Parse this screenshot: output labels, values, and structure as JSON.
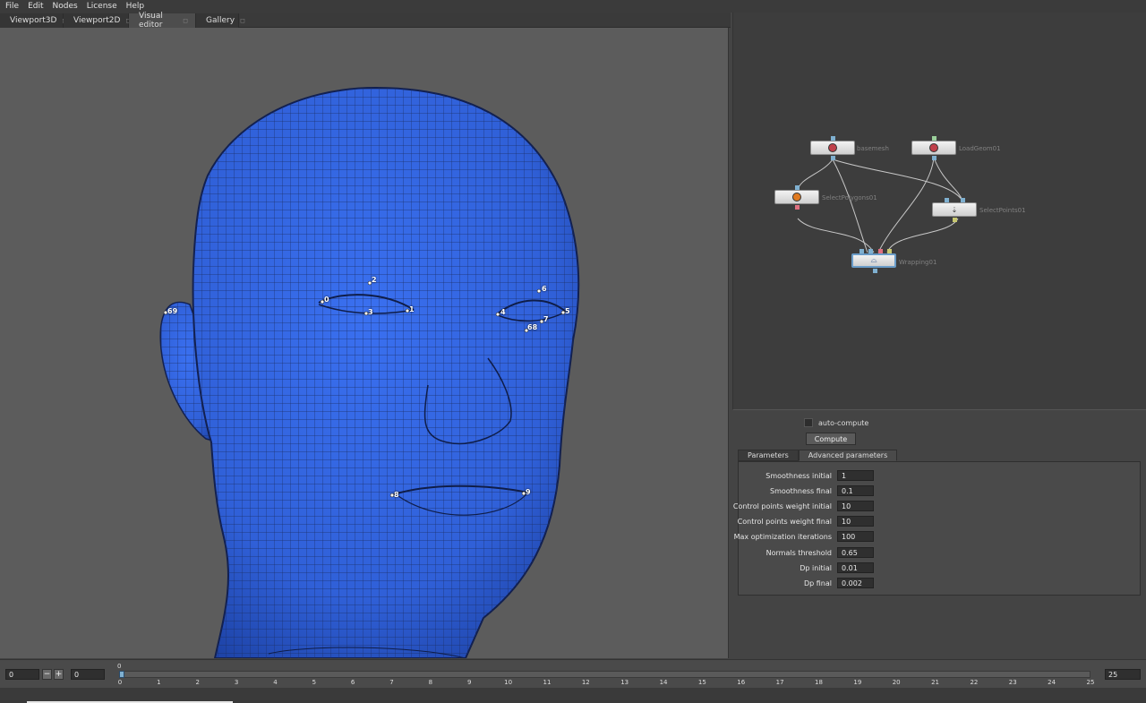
{
  "menu": [
    "File",
    "Edit",
    "Nodes",
    "License",
    "Help"
  ],
  "tabs": [
    {
      "label": "Viewport3D"
    },
    {
      "label": "Viewport2D"
    },
    {
      "label": "Visual editor",
      "active": true
    },
    {
      "label": "Gallery"
    }
  ],
  "landmarks": [
    "0",
    "1",
    "2",
    "3",
    "4",
    "5",
    "6",
    "7",
    "8",
    "9",
    "68",
    "69"
  ],
  "nodes": {
    "basemesh": "basemesh",
    "loadgeom": "LoadGeom01",
    "select_polygons": "SelectPolygons01",
    "select_points": "SelectPoints01",
    "wrapping": "Wrapping01"
  },
  "props": {
    "auto_compute": "auto-compute",
    "compute": "Compute",
    "tabs": [
      "Parameters",
      "Advanced parameters"
    ],
    "params": [
      {
        "label": "Smoothness initial",
        "value": "1"
      },
      {
        "label": "Smoothness final",
        "value": "0.1"
      },
      {
        "label": "Control points weight initial",
        "value": "10"
      },
      {
        "label": "Control points weight final",
        "value": "10"
      },
      {
        "label": "Max optimization iterations",
        "value": "100"
      },
      {
        "label": "Normals threshold",
        "value": "0.65"
      },
      {
        "label": "Dp initial",
        "value": "0.01"
      },
      {
        "label": "Dp final",
        "value": "0.002"
      }
    ]
  },
  "timeline": {
    "start": "0",
    "minus": "−",
    "plus": "+",
    "frame": "0",
    "current": "0",
    "end": "25",
    "ticks": [
      "0",
      "1",
      "2",
      "3",
      "4",
      "5",
      "6",
      "7",
      "8",
      "9",
      "10",
      "11",
      "12",
      "13",
      "14",
      "15",
      "16",
      "17",
      "18",
      "19",
      "20",
      "21",
      "22",
      "23",
      "24",
      "25"
    ]
  },
  "colors": {
    "mesh": "#3366dd",
    "viewport_bg": "#5c5c5c",
    "node_selected": "#6a9cc8"
  }
}
